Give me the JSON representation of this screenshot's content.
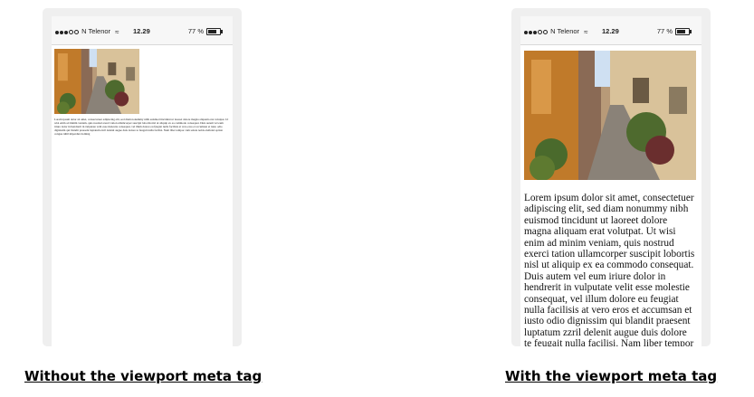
{
  "status_bar": {
    "carrier": "N Telenor",
    "time": "12.29",
    "battery": "77 %"
  },
  "article": {
    "text": "Lorem ipsum dolor sit amet, consectetuer adipiscing elit, sed diam nonummy nibh euismod tincidunt ut laoreet dolore magna aliquam erat volutpat. Ut wisi enim ad minim veniam, quis nostrud exerci tation ullamcorper suscipit lobortis nisl ut aliquip ex ea commodo consequat. Duis autem vel eum iriure dolor in hendrerit in vulputate velit esse molestie consequat, vel illum dolore eu feugiat nulla facilisis at vero eros et accumsan et iusto odio dignissim qui blandit praesent luptatum zzril delenit augue duis dolore te feugait nulla facilisi. Nam liber tempor cum soluta nobis eleifend option congue nihil imperdiet doming"
  },
  "captions": {
    "without": "Without the viewport meta tag",
    "with": "With the viewport meta tag"
  },
  "icons": {
    "signal": "signal-dots-icon",
    "wifi": "wifi-icon",
    "battery": "battery-icon"
  }
}
